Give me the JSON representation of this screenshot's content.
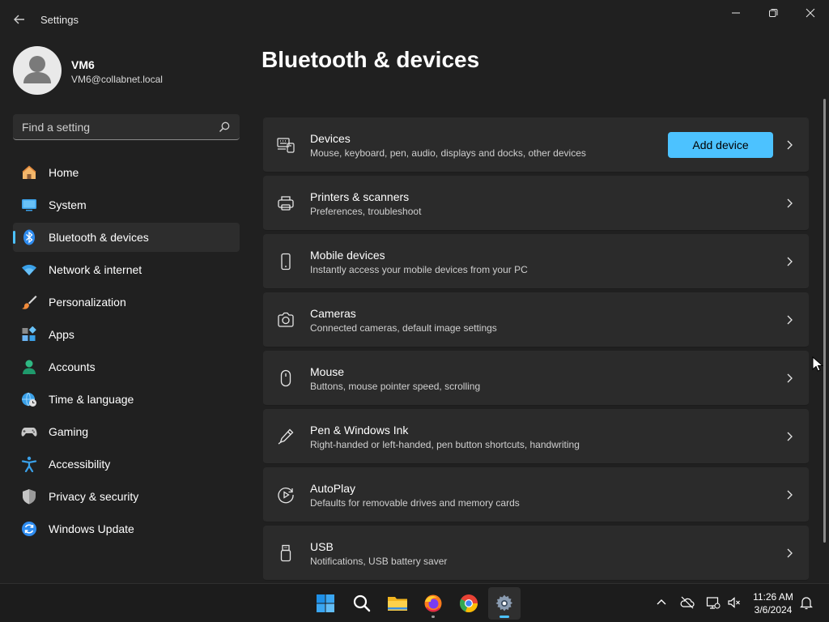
{
  "window": {
    "title": "Settings",
    "controls": [
      "minimize",
      "maximize",
      "close"
    ]
  },
  "user": {
    "name": "VM6",
    "email": "VM6@collabnet.local"
  },
  "search": {
    "placeholder": "Find a setting"
  },
  "sidebar": {
    "items": [
      {
        "label": "Home",
        "icon": "home-icon"
      },
      {
        "label": "System",
        "icon": "system-icon"
      },
      {
        "label": "Bluetooth & devices",
        "icon": "bluetooth-icon",
        "active": true
      },
      {
        "label": "Network & internet",
        "icon": "wifi-icon"
      },
      {
        "label": "Personalization",
        "icon": "brush-icon"
      },
      {
        "label": "Apps",
        "icon": "apps-icon"
      },
      {
        "label": "Accounts",
        "icon": "accounts-icon"
      },
      {
        "label": "Time & language",
        "icon": "globe-clock-icon"
      },
      {
        "label": "Gaming",
        "icon": "gamepad-icon"
      },
      {
        "label": "Accessibility",
        "icon": "accessibility-icon"
      },
      {
        "label": "Privacy & security",
        "icon": "shield-icon"
      },
      {
        "label": "Windows Update",
        "icon": "update-icon"
      }
    ]
  },
  "main": {
    "title": "Bluetooth & devices",
    "cards": [
      {
        "title": "Devices",
        "desc": "Mouse, keyboard, pen, audio, displays and docks, other devices",
        "icon": "devices-icon",
        "button": "Add device"
      },
      {
        "title": "Printers & scanners",
        "desc": "Preferences, troubleshoot",
        "icon": "printer-icon"
      },
      {
        "title": "Mobile devices",
        "desc": "Instantly access your mobile devices from your PC",
        "icon": "phone-icon"
      },
      {
        "title": "Cameras",
        "desc": "Connected cameras, default image settings",
        "icon": "camera-icon"
      },
      {
        "title": "Mouse",
        "desc": "Buttons, mouse pointer speed, scrolling",
        "icon": "mouse-icon"
      },
      {
        "title": "Pen & Windows Ink",
        "desc": "Right-handed or left-handed, pen button shortcuts, handwriting",
        "icon": "pen-icon"
      },
      {
        "title": "AutoPlay",
        "desc": "Defaults for removable drives and memory cards",
        "icon": "autoplay-icon"
      },
      {
        "title": "USB",
        "desc": "Notifications, USB battery saver",
        "icon": "usb-icon"
      }
    ]
  },
  "taskbar": {
    "apps": [
      "start-icon",
      "search-icon",
      "file-explorer-icon",
      "firefox-icon",
      "chrome-icon",
      "settings-icon"
    ],
    "tray": [
      "chevron-up-icon",
      "onedrive-icon",
      "network-icon",
      "volume-muted-icon",
      "notification-icon"
    ],
    "time": "11:26 AM",
    "date": "3/6/2024"
  },
  "colors": {
    "accent": "#4cc2ff",
    "background": "#202020",
    "card": "#2b2b2b"
  }
}
